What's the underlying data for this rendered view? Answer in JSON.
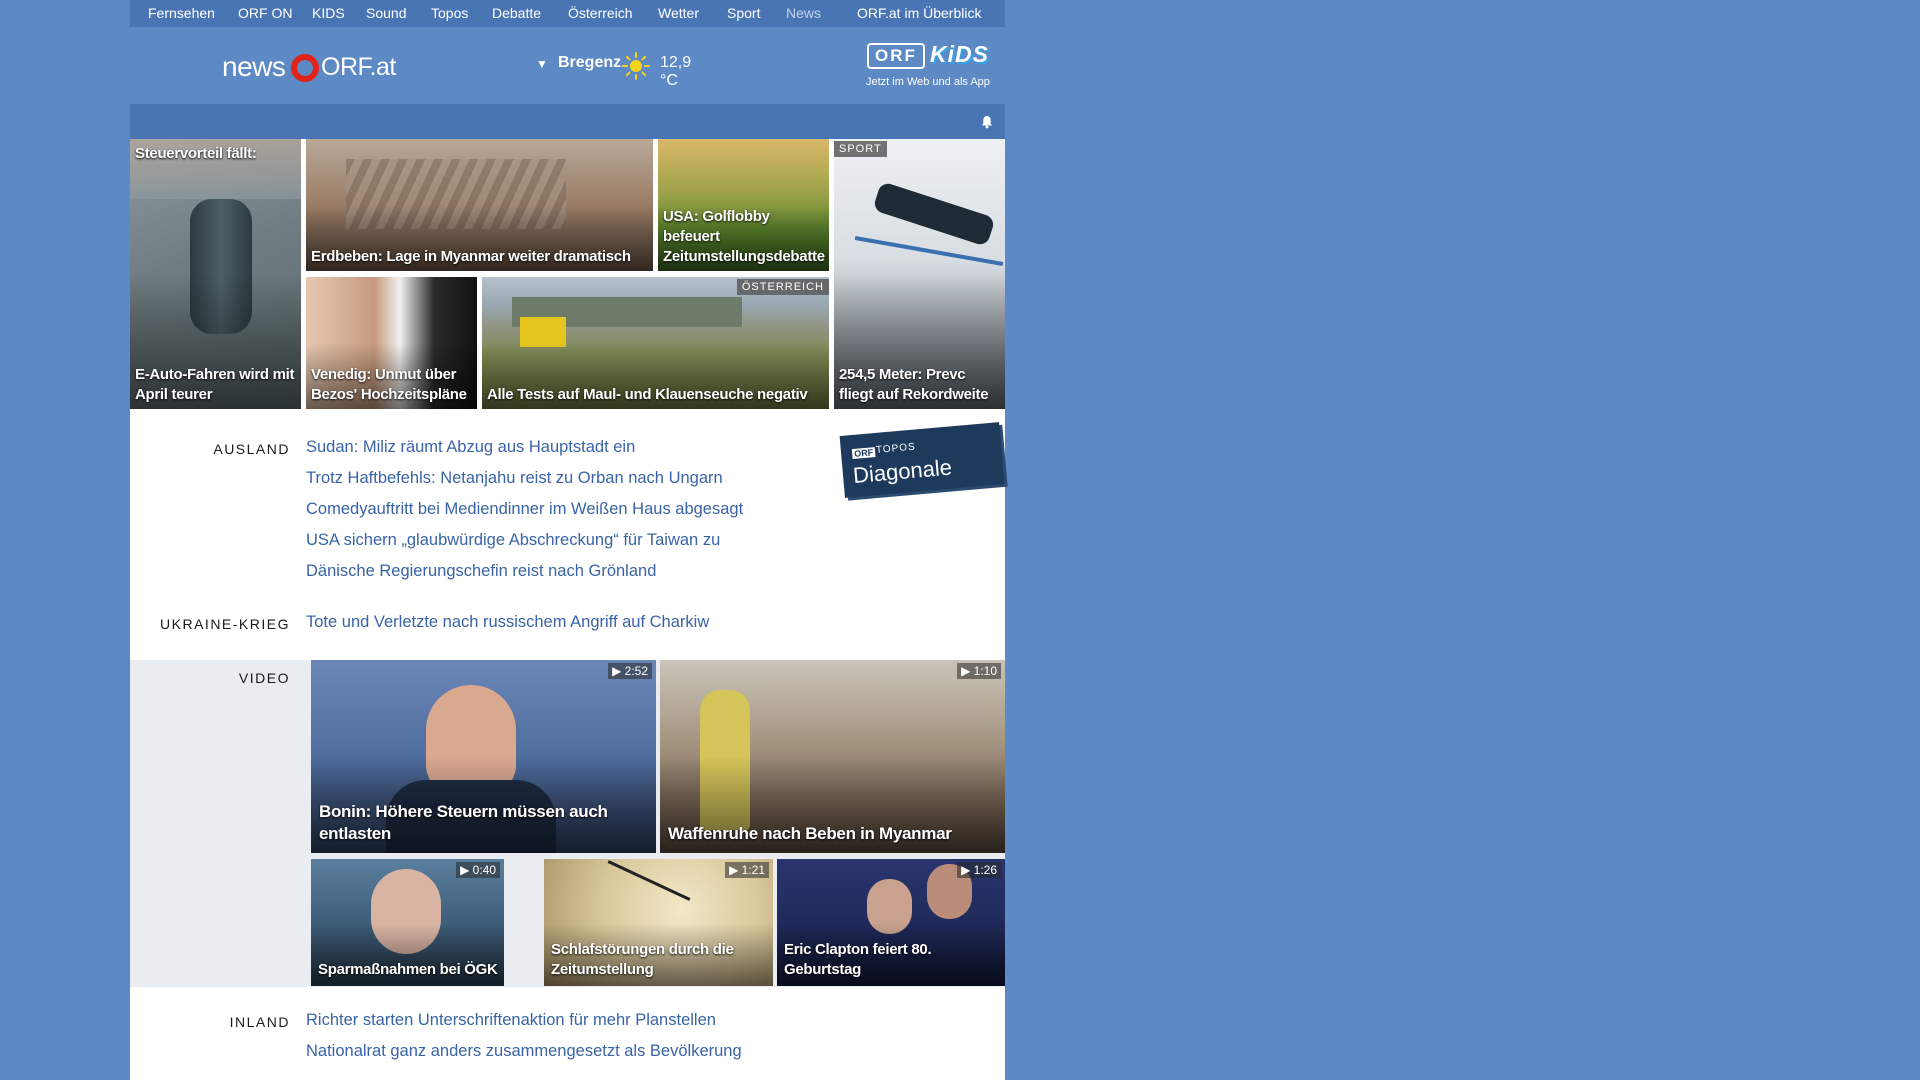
{
  "topnav": {
    "items": [
      "Fernsehen",
      "ORF ON",
      "KIDS",
      "Sound",
      "Topos",
      "Debatte",
      "Österreich",
      "Wetter",
      "Sport",
      "News"
    ],
    "overview": "ORF.at im Überblick"
  },
  "header": {
    "logo_news": "news",
    "logo_orf": "ORF.at",
    "weather": {
      "city": "Bregenz",
      "temp": "12,9 °C",
      "icon": "sun-icon"
    },
    "kids": {
      "orf": "ORF",
      "kids": "KiDS",
      "tagline": "Jetzt im Web und als App"
    }
  },
  "colors": {
    "brand_blue": "#5d89c4",
    "dark_blue": "#4a75b4",
    "link": "#3a63a7",
    "orf_red": "#e2231a"
  },
  "tiles": [
    {
      "label_top": "Steuervorteil fällt:",
      "caption": "E-Auto-Fahren wird mit April teurer"
    },
    {
      "caption": "Erdbeben: Lage in Myanmar weiter dramatisch"
    },
    {
      "caption": "USA: Golflobby befeuert Zeitumstellungsdebatte"
    },
    {
      "badge": "SPORT",
      "caption": "254,5 Meter: Prevc fliegt auf Rekordweite"
    },
    {
      "caption": "Venedig: Unmut über Bezos' Hochzeitspläne"
    },
    {
      "badge": "ÖSTERREICH",
      "caption": "Alle Tests auf Maul- und Klauenseuche negativ"
    }
  ],
  "ausland": {
    "label": "AUSLAND",
    "items": [
      "Sudan: Miliz räumt Abzug aus Hauptstadt ein",
      "Trotz Haftbefehls: Netanjahu reist zu Orban nach Ungarn",
      "Comedyauftritt bei Mediendinner im Weißen Haus abgesagt",
      "USA sichern „glaubwürdige Abschreckung“ für Taiwan zu",
      "Dänische Regierungschefin reist nach Grönland"
    ]
  },
  "topos": {
    "orf": "ORF",
    "label": "TOPOS",
    "title": "Diagonale"
  },
  "ukraine": {
    "label": "UKRAINE-KRIEG",
    "items": [
      "Tote und Verletzte nach russischem Angriff auf Charkiw"
    ]
  },
  "video": {
    "label": "VIDEO",
    "items": [
      {
        "duration": "2:52",
        "caption": "Bonin: Höhere Steuern müssen auch entlasten"
      },
      {
        "duration": "1:10",
        "caption": "Waffenruhe nach Beben in Myanmar"
      },
      {
        "duration": "0:40",
        "caption": "Sparmaßnahmen bei ÖGK"
      },
      {
        "duration": "1:21",
        "caption": "Schlafstörungen durch die Zeitumstellung"
      },
      {
        "duration": "1:26",
        "caption": "Eric Clapton feiert 80. Geburtstag"
      }
    ]
  },
  "inland": {
    "label": "INLAND",
    "items": [
      "Richter starten Unterschriftenaktion für mehr Planstellen",
      "Nationalrat ganz anders zusammengesetzt als Bevölkerung"
    ]
  }
}
